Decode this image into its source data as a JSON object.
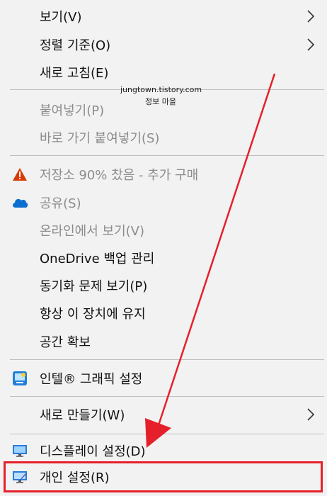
{
  "menu": {
    "items": [
      {
        "label": "보기(V)"
      },
      {
        "label": "정렬 기준(O)"
      },
      {
        "label": "새로 고침(E)"
      },
      {
        "label": "붙여넣기(P)"
      },
      {
        "label": "바로 가기 붙여넣기(S)"
      },
      {
        "label": "저장소 90% 찼음 - 추가 구매"
      },
      {
        "label": "공유(S)"
      },
      {
        "label": "온라인에서 보기(V)"
      },
      {
        "label": "OneDrive 백업 관리"
      },
      {
        "label": "동기화 문제 보기(P)"
      },
      {
        "label": "항상 이 장치에 유지"
      },
      {
        "label": "공간 확보"
      },
      {
        "label": "인텔® 그래픽 설정"
      },
      {
        "label": "새로 만들기(W)"
      },
      {
        "label": "디스플레이 설정(D)"
      },
      {
        "label": "개인 설정(R)"
      }
    ]
  },
  "watermark": {
    "site": "jungtown.tistory.com",
    "name": "정보 마을"
  },
  "colors": {
    "annotation_red": "#e5202a",
    "warning": "#d83b01",
    "onedrive": "#0a6fd1"
  }
}
